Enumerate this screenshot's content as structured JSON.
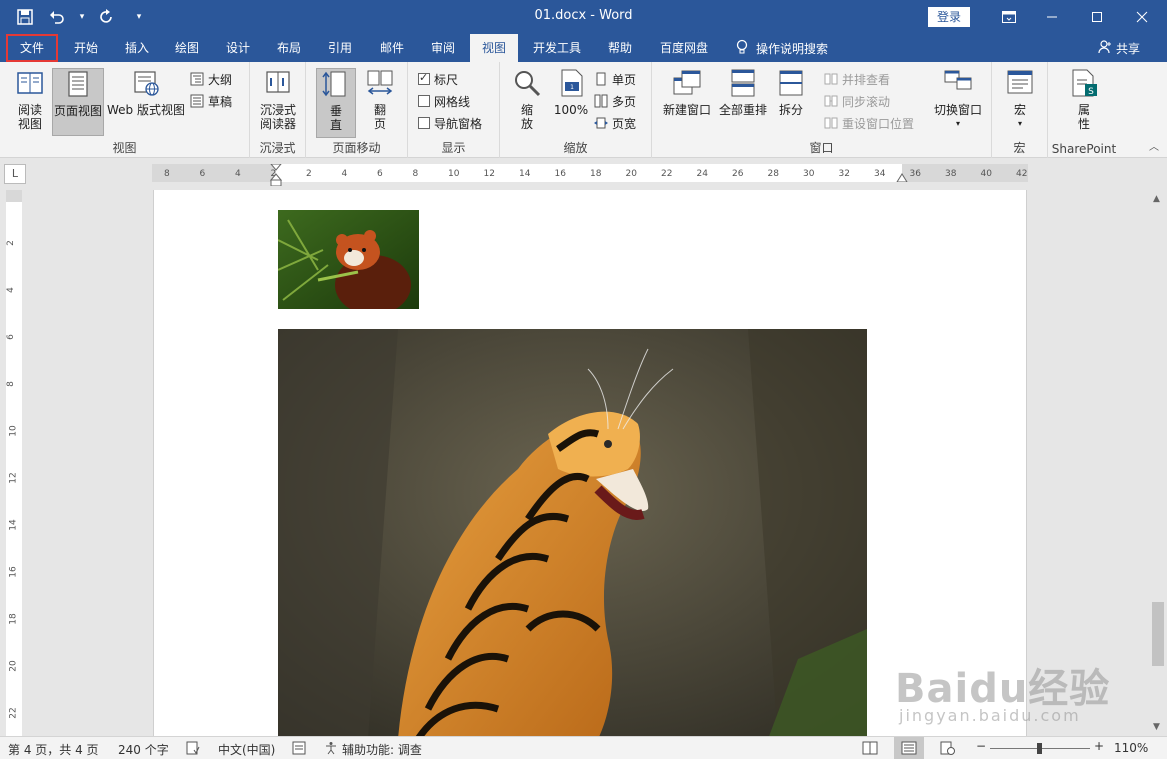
{
  "titlebar": {
    "doc_title": "01.docx  -  Word",
    "login": "登录",
    "customize_glyph": "▾"
  },
  "tabs": [
    {
      "id": "file",
      "label": "文件"
    },
    {
      "id": "home",
      "label": "开始"
    },
    {
      "id": "insert",
      "label": "插入"
    },
    {
      "id": "draw",
      "label": "绘图"
    },
    {
      "id": "design",
      "label": "设计"
    },
    {
      "id": "layout",
      "label": "布局"
    },
    {
      "id": "references",
      "label": "引用"
    },
    {
      "id": "mailings",
      "label": "邮件"
    },
    {
      "id": "review",
      "label": "审阅"
    },
    {
      "id": "view",
      "label": "视图"
    },
    {
      "id": "developer",
      "label": "开发工具"
    },
    {
      "id": "help",
      "label": "帮助"
    },
    {
      "id": "baidu",
      "label": "百度网盘"
    }
  ],
  "tell_me": "操作说明搜索",
  "share": "共享",
  "ribbon": {
    "view_group": {
      "label": "视图",
      "read_mode": "阅读\n视图",
      "print_layout": "页面视图",
      "web_layout": "Web 版式视图",
      "outline": "大纲",
      "draft": "草稿"
    },
    "immersive_group": {
      "label": "沉浸式",
      "reader": "沉浸式\n阅读器"
    },
    "page_move_group": {
      "label": "页面移动",
      "vertical": "垂\n直",
      "side_to_side": "翻\n页"
    },
    "show_group": {
      "label": "显示",
      "ruler": "标尺",
      "gridlines": "网格线",
      "nav_pane": "导航窗格"
    },
    "zoom_group": {
      "label": "缩放",
      "zoom": "缩\n放",
      "zoom100": "100%",
      "one_page": "单页",
      "multi_page": "多页",
      "page_width": "页宽"
    },
    "window_group": {
      "label": "窗口",
      "new_window": "新建窗口",
      "arrange_all": "全部重排",
      "split": "拆分",
      "side_by_side": "并排查看",
      "sync_scroll": "同步滚动",
      "reset_pos": "重设窗口位置",
      "switch_windows": "切换窗口"
    },
    "macro_group": {
      "label": "宏",
      "macros": "宏"
    },
    "sharepoint_group": {
      "label": "SharePoint",
      "properties": "属\n性"
    }
  },
  "ruler_ticks": [
    "8",
    "6",
    "4",
    "2",
    "2",
    "4",
    "6",
    "8",
    "10",
    "12",
    "14",
    "16",
    "18",
    "20",
    "22",
    "24",
    "26",
    "28",
    "30",
    "32",
    "34",
    "36",
    "38",
    "40",
    "42"
  ],
  "vruler_ticks": [
    "2",
    "4",
    "6",
    "8",
    "10",
    "12",
    "14",
    "16",
    "18",
    "20",
    "22"
  ],
  "statusbar": {
    "page": "第 4 页，共 4 页",
    "words": "240 个字",
    "language": "中文(中国)",
    "accessibility": "辅助功能: 调查",
    "zoom": "110%"
  },
  "watermark": {
    "logo": "Baidu经验",
    "sub": "jingyan.baidu.com"
  },
  "colors": {
    "accent": "#2b579a",
    "file_highlight": "#e53935"
  }
}
